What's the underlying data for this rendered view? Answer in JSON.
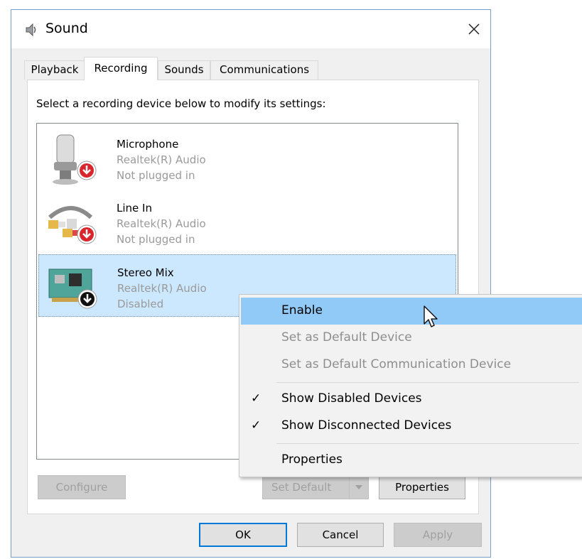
{
  "window": {
    "title": "Sound"
  },
  "tabs": [
    {
      "label": "Playback"
    },
    {
      "label": "Recording"
    },
    {
      "label": "Sounds"
    },
    {
      "label": "Communications"
    }
  ],
  "panel": {
    "instruction": "Select a recording device below to modify its settings:",
    "devices": [
      {
        "name": "Microphone",
        "driver": "Realtek(R) Audio",
        "status": "Not plugged in",
        "icon": "microphone-icon"
      },
      {
        "name": "Line In",
        "driver": "Realtek(R) Audio",
        "status": "Not plugged in",
        "icon": "line-in-cable-icon"
      },
      {
        "name": "Stereo Mix",
        "driver": "Realtek(R) Audio",
        "status": "Disabled",
        "icon": "sound-card-icon"
      }
    ],
    "buttons": {
      "configure": "Configure",
      "set_default": "Set Default",
      "properties": "Properties"
    }
  },
  "dialog_buttons": {
    "ok": "OK",
    "cancel": "Cancel",
    "apply": "Apply"
  },
  "context_menu": {
    "items": [
      {
        "label": "Enable",
        "state": "highlighted"
      },
      {
        "label": "Set as Default Device",
        "state": "disabled"
      },
      {
        "label": "Set as Default Communication Device",
        "state": "disabled"
      },
      {
        "label": "Show Disabled Devices",
        "checked": true
      },
      {
        "label": "Show Disconnected Devices",
        "checked": true
      },
      {
        "label": "Properties"
      }
    ],
    "check_glyph": "✓"
  },
  "colors": {
    "selection": "#cce8ff",
    "menu_highlight": "#91c9f7",
    "accent": "#0078d7"
  }
}
